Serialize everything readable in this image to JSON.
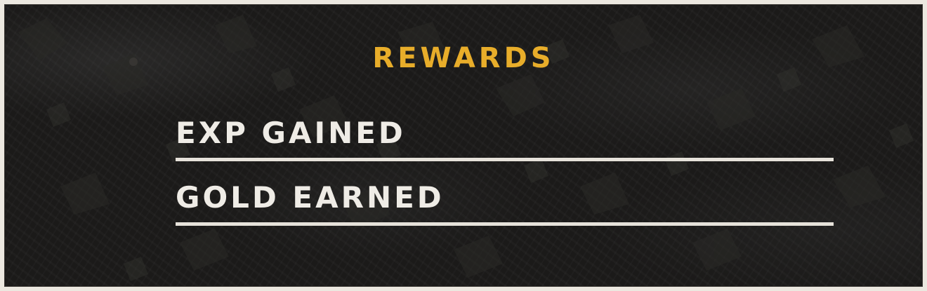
{
  "rewards_panel": {
    "title": "REWARDS",
    "rows": [
      {
        "label": "EXP GAINED"
      },
      {
        "label": "GOLD EARNED"
      }
    ]
  },
  "colors": {
    "title": "#e8ad2a",
    "label": "#efece6",
    "background": "#1b1a19",
    "border": "#ece8e0"
  }
}
